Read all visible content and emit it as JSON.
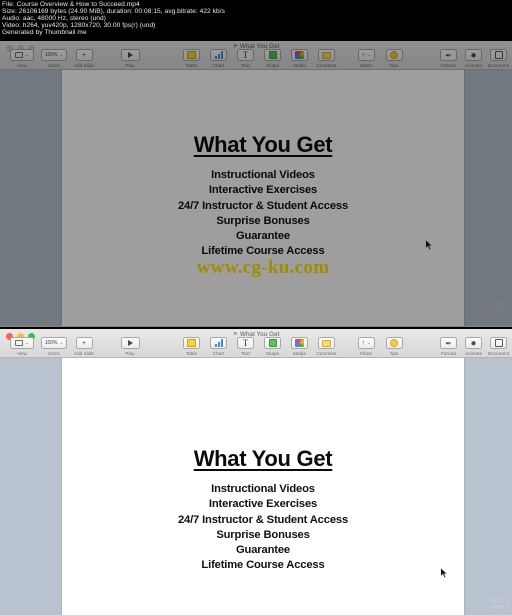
{
  "info_header": {
    "lines": [
      "File: Course Overview & How to Succeed.mp4",
      "Size: 26106169 bytes (24.90 MiB), duration: 00:08:15, avg.bitrate: 422 kb/s",
      "Audio: aac, 48000 Hz, stereo (und)",
      "Video: h264, yuv420p, 1280x720, 30.00 fps(r) (und)",
      "Generated by Thumbnail me"
    ]
  },
  "window": {
    "title": "What You Get",
    "title_glyph": "⚑",
    "toolbar": {
      "left": [
        {
          "label": "View",
          "icon": "view-icon",
          "caret": "⌄"
        },
        {
          "label": "Zoom",
          "icon": "zoom-icon",
          "value": "100%",
          "caret": "⌄"
        },
        {
          "label": "Add Slide",
          "icon": "plus-icon",
          "glyph": "+"
        }
      ],
      "play": {
        "label": "Play",
        "icon": "play-icon"
      },
      "insert": [
        {
          "label": "Table",
          "icon": "table-icon"
        },
        {
          "label": "Chart",
          "icon": "chart-icon"
        },
        {
          "label": "Text",
          "icon": "text-icon",
          "glyph": "T"
        },
        {
          "label": "Shape",
          "icon": "shape-icon"
        },
        {
          "label": "Media",
          "icon": "media-icon"
        },
        {
          "label": "Comment",
          "icon": "comment-icon"
        }
      ],
      "share": [
        {
          "label": "Share",
          "icon": "share-icon",
          "glyph": "↑",
          "caret": "⌄"
        },
        {
          "label": "Tips",
          "icon": "tips-icon"
        }
      ],
      "inspector": [
        {
          "label": "Format",
          "icon": "brush-icon",
          "glyph": "✒"
        },
        {
          "label": "Animate",
          "icon": "animate-icon",
          "glyph": "✸"
        },
        {
          "label": "Document",
          "icon": "document-icon"
        }
      ]
    }
  },
  "slide": {
    "title": "What You Get",
    "lines": [
      "Instructional Videos",
      "Interactive Exercises",
      "24/7 Instructor & Student Access",
      "Surprise Bonuses",
      "Guarantee",
      "Lifetime Course Access"
    ]
  },
  "watermark": {
    "site": "www.cg-ku.com",
    "color": "#ffe400",
    "brand": "udemy",
    "brand_sub": "9906681"
  },
  "colors": {
    "window_chrome": "#e4e4e4",
    "nav_panel": "#b9c2cf",
    "canvas": "#ffffff",
    "header_bg": "#000000",
    "header_text": "#e8e8e8"
  }
}
